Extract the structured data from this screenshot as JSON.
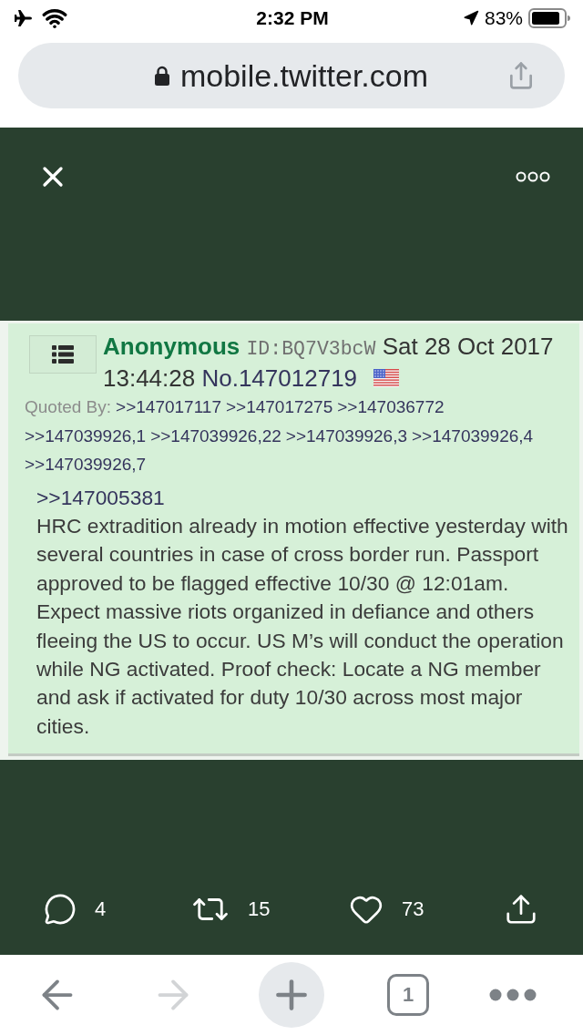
{
  "status_bar": {
    "time": "2:32 PM",
    "battery": "83%"
  },
  "browser": {
    "url": "mobile.twitter.com"
  },
  "post": {
    "name": "Anonymous",
    "poster_id": "ID:BQ7V3bcW",
    "date": "Sat 28 Oct 2017",
    "time": "13:44:28",
    "number": "No.147012719",
    "quoted_by_label": "Quoted By:",
    "quoted_by": [
      ">>147017117",
      ">>147017275",
      ">>147036772",
      ">>147039926,1",
      ">>147039926,22",
      ">>147039926,3",
      ">>147039926,4",
      ">>147039926,7"
    ],
    "reply_to": ">>147005381",
    "message": "HRC extradition already in motion effective yesterday with several countries in case of cross border run. Passport approved to be flagged effective 10/30 @ 12:01am. Expect massive riots organized in defiance and others fleeing the US to occur. US M’s will conduct the operation while NG activated. Proof check: Locate a NG member and ask if activated for duty 10/30 across most major cities."
  },
  "actions": [
    {
      "kind": "reply",
      "count": "4"
    },
    {
      "kind": "retweet",
      "count": "15"
    },
    {
      "kind": "like",
      "count": "73"
    },
    {
      "kind": "share"
    }
  ],
  "toolbar": [
    {
      "kind": "back",
      "disabled": false
    },
    {
      "kind": "forward",
      "disabled": true
    },
    {
      "kind": "new-tab",
      "disabled": false
    },
    {
      "kind": "tabs",
      "label": "1",
      "disabled": false
    },
    {
      "kind": "more",
      "disabled": false
    }
  ]
}
